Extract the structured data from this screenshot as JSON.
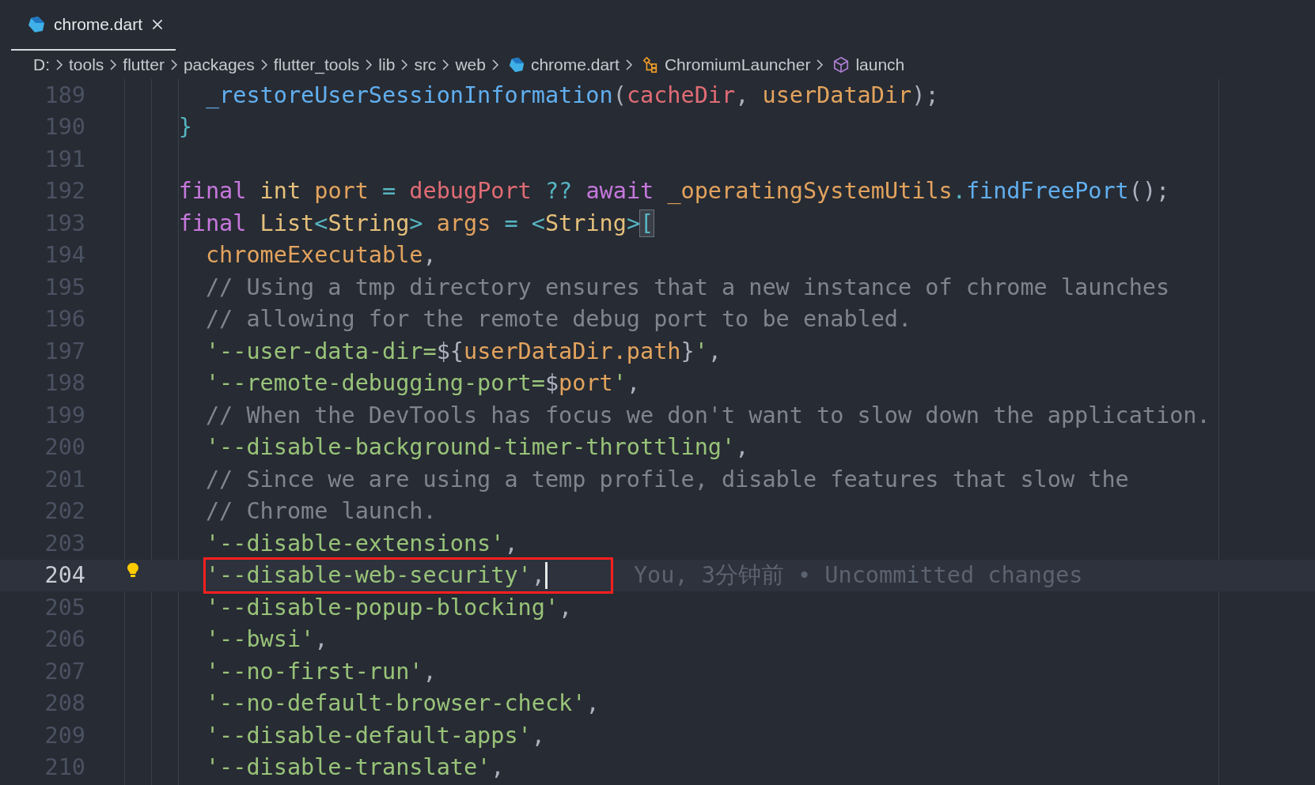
{
  "tabs": [
    {
      "label": "chrome.dart",
      "selected": true
    }
  ],
  "breadcrumb": [
    {
      "kind": "folder",
      "label": "D:"
    },
    {
      "kind": "folder",
      "label": "tools"
    },
    {
      "kind": "folder",
      "label": "flutter"
    },
    {
      "kind": "folder",
      "label": "packages"
    },
    {
      "kind": "folder",
      "label": "flutter_tools"
    },
    {
      "kind": "folder",
      "label": "lib"
    },
    {
      "kind": "folder",
      "label": "src"
    },
    {
      "kind": "folder",
      "label": "web"
    },
    {
      "kind": "file",
      "label": "chrome.dart"
    },
    {
      "kind": "class",
      "label": "ChromiumLauncher"
    },
    {
      "kind": "method",
      "label": "launch"
    }
  ],
  "lines": [
    {
      "number": "189",
      "kind": "inner",
      "current": false,
      "tokens": [
        {
          "kind": "function",
          "text": "_restoreUserSessionInformation"
        },
        {
          "kind": "punct",
          "text": "("
        },
        {
          "kind": "param",
          "text": "cacheDir"
        },
        {
          "kind": "punct",
          "text": ", "
        },
        {
          "kind": "local",
          "text": "userDataDir"
        },
        {
          "kind": "punct",
          "text": ");"
        }
      ]
    },
    {
      "number": "190",
      "kind": "outer",
      "current": false,
      "tokens": [
        {
          "kind": "operator",
          "text": "}"
        }
      ]
    },
    {
      "number": "191",
      "kind": "blank",
      "current": false
    },
    {
      "number": "192",
      "kind": "outer",
      "current": false,
      "tokens": [
        {
          "kind": "keyword",
          "text": "final "
        },
        {
          "kind": "type",
          "text": "int "
        },
        {
          "kind": "local",
          "text": "port"
        },
        {
          "kind": "operator",
          "text": " = "
        },
        {
          "kind": "param",
          "text": "debugPort"
        },
        {
          "kind": "operator",
          "text": " ?? "
        },
        {
          "kind": "keyword",
          "text": "await "
        },
        {
          "kind": "local",
          "text": "_operatingSystemUtils"
        },
        {
          "kind": "operator",
          "text": "."
        },
        {
          "kind": "function",
          "text": "findFreePort"
        },
        {
          "kind": "punct",
          "text": "();"
        }
      ]
    },
    {
      "number": "193",
      "kind": "outer",
      "current": false,
      "tokens": [
        {
          "kind": "keyword",
          "text": "final "
        },
        {
          "kind": "type",
          "text": "List"
        },
        {
          "kind": "operator",
          "text": "<"
        },
        {
          "kind": "type",
          "text": "String"
        },
        {
          "kind": "operator",
          "text": "> "
        },
        {
          "kind": "local",
          "text": "args"
        },
        {
          "kind": "operator",
          "text": " = <"
        },
        {
          "kind": "type",
          "text": "String"
        },
        {
          "kind": "operator",
          "text": ">"
        },
        {
          "kind": "operator",
          "text": "[",
          "matched": true
        }
      ]
    },
    {
      "number": "194",
      "kind": "inner",
      "current": false,
      "tokens": [
        {
          "kind": "local",
          "text": "chromeExecutable"
        },
        {
          "kind": "punct",
          "text": ","
        }
      ]
    },
    {
      "number": "195",
      "kind": "inner",
      "current": false,
      "tokens": [
        {
          "kind": "comment",
          "text": "// Using a tmp directory ensures that a new instance of chrome launches"
        }
      ]
    },
    {
      "number": "196",
      "kind": "inner",
      "current": false,
      "tokens": [
        {
          "kind": "comment",
          "text": "// allowing for the remote debug port to be enabled."
        }
      ]
    },
    {
      "number": "197",
      "kind": "inner",
      "current": false,
      "tokens": [
        {
          "kind": "string",
          "text": "'--user-data-dir="
        },
        {
          "kind": "punct",
          "text": "${"
        },
        {
          "kind": "local",
          "text": "userDataDir.path"
        },
        {
          "kind": "punct",
          "text": "}"
        },
        {
          "kind": "string",
          "text": "'"
        },
        {
          "kind": "punct",
          "text": ","
        }
      ]
    },
    {
      "number": "198",
      "kind": "inner",
      "current": false,
      "tokens": [
        {
          "kind": "string",
          "text": "'--remote-debugging-port="
        },
        {
          "kind": "punct",
          "text": "$"
        },
        {
          "kind": "local",
          "text": "port"
        },
        {
          "kind": "string",
          "text": "'"
        },
        {
          "kind": "punct",
          "text": ","
        }
      ]
    },
    {
      "number": "199",
      "kind": "inner",
      "current": false,
      "tokens": [
        {
          "kind": "comment",
          "text": "// When the DevTools has focus we don't want to slow down the application."
        }
      ]
    },
    {
      "number": "200",
      "kind": "inner",
      "current": false,
      "tokens": [
        {
          "kind": "string",
          "text": "'--disable-background-timer-throttling'"
        },
        {
          "kind": "punct",
          "text": ","
        }
      ]
    },
    {
      "number": "201",
      "kind": "inner",
      "current": false,
      "tokens": [
        {
          "kind": "comment",
          "text": "// Since we are using a temp profile, disable features that slow the"
        }
      ]
    },
    {
      "number": "202",
      "kind": "inner",
      "current": false,
      "tokens": [
        {
          "kind": "comment",
          "text": "// Chrome launch."
        }
      ]
    },
    {
      "number": "203",
      "kind": "inner",
      "current": false,
      "tokens": [
        {
          "kind": "string",
          "text": "'--disable-extensions'"
        },
        {
          "kind": "punct",
          "text": ","
        }
      ]
    },
    {
      "number": "204",
      "kind": "inner",
      "current": true,
      "lightbulb": true,
      "boxed": true,
      "cursor": true,
      "blame": "You, 3分钟前 • Uncommitted changes",
      "tokens": [
        {
          "kind": "string",
          "text": "'--disable-web-security'"
        },
        {
          "kind": "punct",
          "text": ","
        }
      ]
    },
    {
      "number": "205",
      "kind": "inner",
      "current": false,
      "tokens": [
        {
          "kind": "string",
          "text": "'--disable-popup-blocking'"
        },
        {
          "kind": "punct",
          "text": ","
        }
      ]
    },
    {
      "number": "206",
      "kind": "inner",
      "current": false,
      "tokens": [
        {
          "kind": "string",
          "text": "'--bwsi'"
        },
        {
          "kind": "punct",
          "text": ","
        }
      ]
    },
    {
      "number": "207",
      "kind": "inner",
      "current": false,
      "tokens": [
        {
          "kind": "string",
          "text": "'--no-first-run'"
        },
        {
          "kind": "punct",
          "text": ","
        }
      ]
    },
    {
      "number": "208",
      "kind": "inner",
      "current": false,
      "tokens": [
        {
          "kind": "string",
          "text": "'--no-default-browser-check'"
        },
        {
          "kind": "punct",
          "text": ","
        }
      ]
    },
    {
      "number": "209",
      "kind": "inner",
      "current": false,
      "tokens": [
        {
          "kind": "string",
          "text": "'--disable-default-apps'"
        },
        {
          "kind": "punct",
          "text": ","
        }
      ]
    },
    {
      "number": "210",
      "kind": "inner",
      "current": false,
      "tokens": [
        {
          "kind": "string",
          "text": "'--disable-translate'"
        },
        {
          "kind": "punct",
          "text": ","
        }
      ]
    }
  ]
}
